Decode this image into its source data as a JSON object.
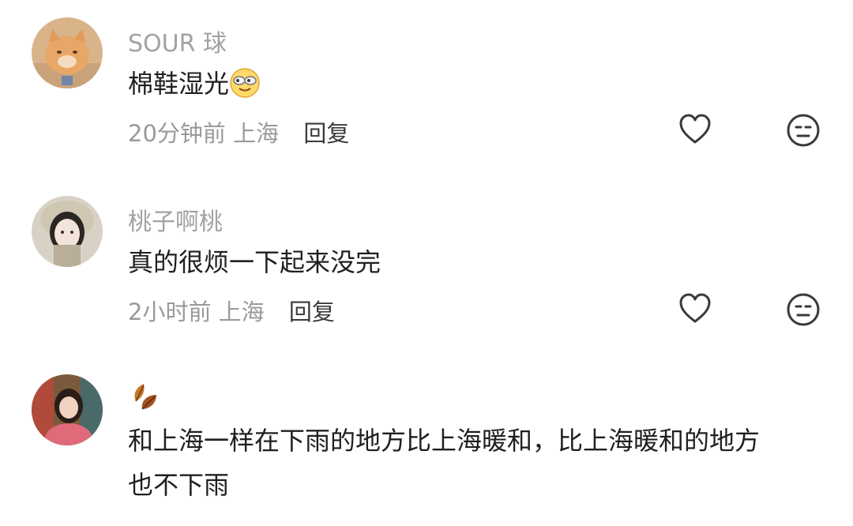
{
  "comments": [
    {
      "username": "SOUR 球",
      "text": "棉鞋湿光",
      "text_emoji": "sunglasses-smile-emoji",
      "time": "20分钟前",
      "location": "上海",
      "reply_label": "回复",
      "avatar": "orange-cat-avatar"
    },
    {
      "username": "桃子啊桃",
      "text": "真的很烦一下起来没完",
      "time": "2小时前",
      "location": "上海",
      "reply_label": "回复",
      "avatar": "girl-in-beige-hat-avatar"
    },
    {
      "username_emoji": "autumn-leaves-emoji",
      "text_line1": "和上海一样在下雨的地方比上海暖和，比上海暖和的地方",
      "text_line2": "也不下雨",
      "avatar": "girl-in-pink-sweater-avatar"
    }
  ],
  "icons": {
    "like": "heart-outline-icon",
    "dislike": "meh-face-icon"
  }
}
